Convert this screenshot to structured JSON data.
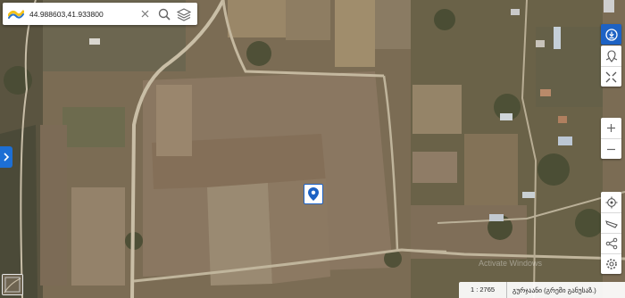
{
  "search": {
    "value": "44.988603,41.933800",
    "placeholder": ""
  },
  "icons": {
    "logo": "ribbon-logo-icon",
    "clear": "close-icon",
    "search": "search-icon",
    "layers": "layers-icon"
  },
  "right_toolbar": {
    "buttons": [
      "info-icon",
      "tracking-icon",
      "fullscreen-icon",
      "zoom-in-icon",
      "zoom-out-icon",
      "locate-icon",
      "measure-icon",
      "share-icon",
      "settings-icon"
    ]
  },
  "status": {
    "scale": "1 : 2765",
    "location": "გურჯაანი (გრემი განუსაზ.)"
  },
  "watermark": "Activate Windows",
  "colors": {
    "accent": "#1d62c4",
    "logo_yellow": "#f4c21a"
  }
}
